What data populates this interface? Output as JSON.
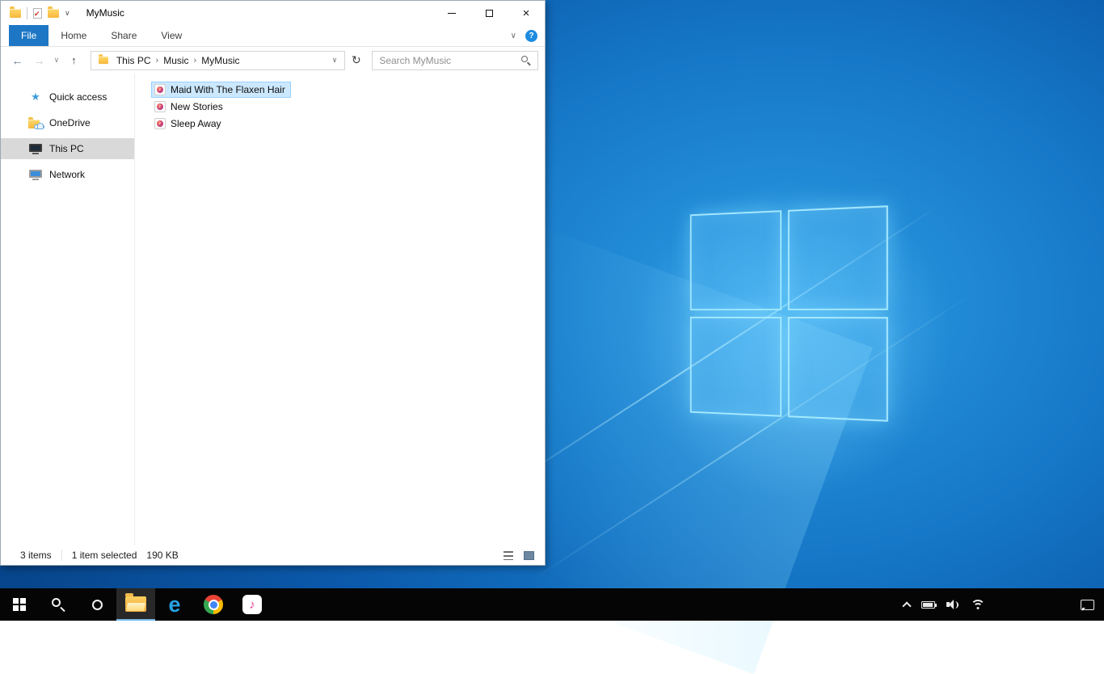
{
  "colors": {
    "accent": "#0078d7",
    "file_tab_bg": "#1d77c4",
    "selection_bg": "#cce8ff",
    "selection_border": "#99d1ff",
    "nav_selected_bg": "#d9d9d9",
    "taskbar_bg": "#050505",
    "taskbar_active_underline": "#76b9ed",
    "desktop_blue": "#1576c6"
  },
  "window": {
    "title": "MyMusic",
    "controls": {
      "close_glyph": "×"
    },
    "qat": {
      "dropdown_glyph": "∨"
    },
    "ribbon": {
      "tabs": [
        "File",
        "Home",
        "Share",
        "View"
      ],
      "active_tab": "File",
      "collapse_glyph": "∨",
      "help_glyph": "?"
    },
    "nav": {
      "back_glyph": "←",
      "forward_glyph": "→",
      "recent_glyph": "∨",
      "up_glyph": "↑",
      "refresh_glyph": "↻",
      "address_dropdown_glyph": "∨",
      "breadcrumb": [
        "This PC",
        "Music",
        "MyMusic"
      ],
      "crumb_sep": "›",
      "search_placeholder": "Search MyMusic"
    },
    "sidebar": {
      "items": [
        {
          "label": "Quick access",
          "icon": "star-icon",
          "selected": false
        },
        {
          "label": "OneDrive",
          "icon": "onedrive-icon",
          "selected": false
        },
        {
          "label": "This PC",
          "icon": "computer-icon",
          "selected": true
        },
        {
          "label": "Network",
          "icon": "network-icon",
          "selected": false
        }
      ]
    },
    "files": [
      {
        "name": "Maid With The Flaxen Hair",
        "icon": "music-file-icon",
        "selected": true
      },
      {
        "name": "New Stories",
        "icon": "music-file-icon",
        "selected": false
      },
      {
        "name": "Sleep Away",
        "icon": "music-file-icon",
        "selected": false
      }
    ],
    "statusbar": {
      "item_count": "3 items",
      "selection": "1 item selected",
      "size": "190 KB"
    }
  },
  "taskbar": {
    "buttons": [
      {
        "name": "start"
      },
      {
        "name": "search"
      },
      {
        "name": "cortana"
      },
      {
        "name": "file-explorer",
        "active": true
      },
      {
        "name": "edge",
        "glyph": "e"
      },
      {
        "name": "chrome"
      },
      {
        "name": "itunes",
        "glyph": "♪"
      }
    ],
    "tray": [
      "tray-expand",
      "battery",
      "volume",
      "network",
      "action-center"
    ]
  }
}
